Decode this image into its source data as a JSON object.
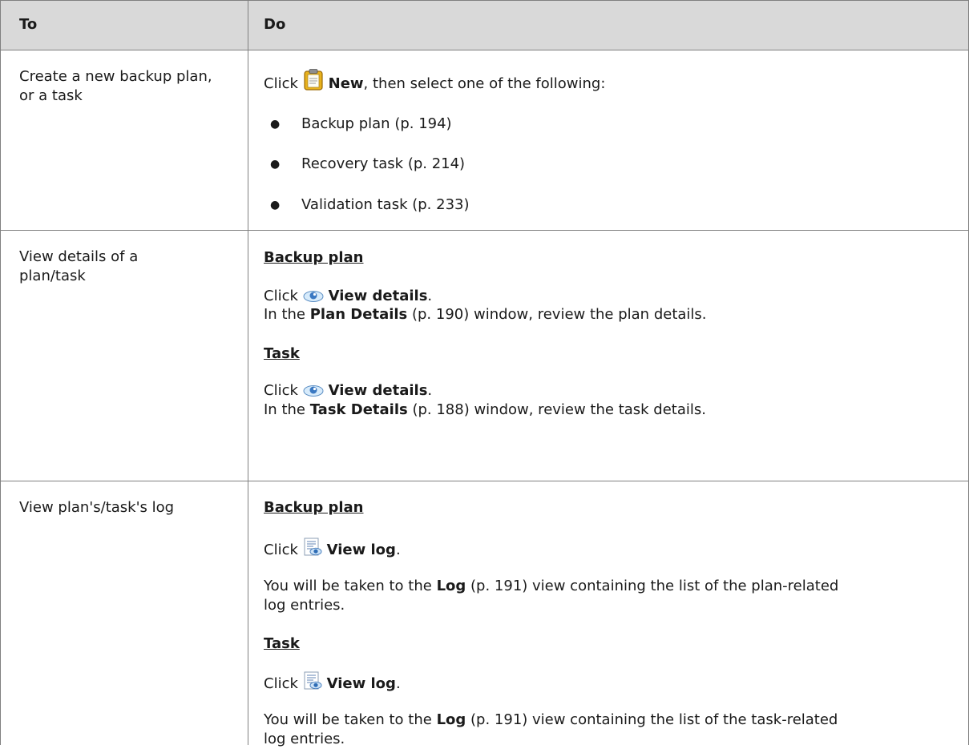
{
  "header": {
    "col_to": "To",
    "col_do": "Do"
  },
  "rows": [
    {
      "to": "Create a new backup plan, or a task",
      "click_prefix": "Click",
      "button_label": "New",
      "intro_suffix": ", then select one of the following:",
      "bullets": [
        {
          "label": "Backup plan",
          "ref": "(p. 194)"
        },
        {
          "label": "Recovery task",
          "ref": "(p. 214)"
        },
        {
          "label": "Validation task",
          "ref": "(p. 233)"
        }
      ]
    },
    {
      "to": "View details of a plan/task",
      "sections": [
        {
          "heading": "Backup plan",
          "click_prefix": "Click",
          "button_label": "View details",
          "period": ".",
          "in_the": "In the",
          "window_name": "Plan Details",
          "rest": " (p. 190) window, review the plan details."
        },
        {
          "heading": "Task",
          "click_prefix": "Click",
          "button_label": "View details",
          "period": ".",
          "in_the": "In the",
          "window_name": "Task Details",
          "rest": " (p. 188) window, review the task details."
        }
      ]
    },
    {
      "to": "View plan's/task's log",
      "sections": [
        {
          "heading": "Backup plan",
          "click_prefix": "Click",
          "button_label": "View log",
          "period": ".",
          "line1_prefix": "You will be taken to the",
          "log_name": "Log",
          "line1_rest": " (p. 191) view containing the list of the plan-related",
          "line2": "log entries."
        },
        {
          "heading": "Task",
          "click_prefix": "Click",
          "button_label": "View log",
          "period": ".",
          "line1_prefix": "You will be taken to the",
          "log_name": "Log",
          "line1_rest": " (p. 191) view containing the list of the task-related",
          "line2": "log entries."
        }
      ]
    }
  ],
  "icons": {
    "new": "clipboard-icon",
    "view_details": "eye-icon",
    "view_log": "log-icon"
  }
}
